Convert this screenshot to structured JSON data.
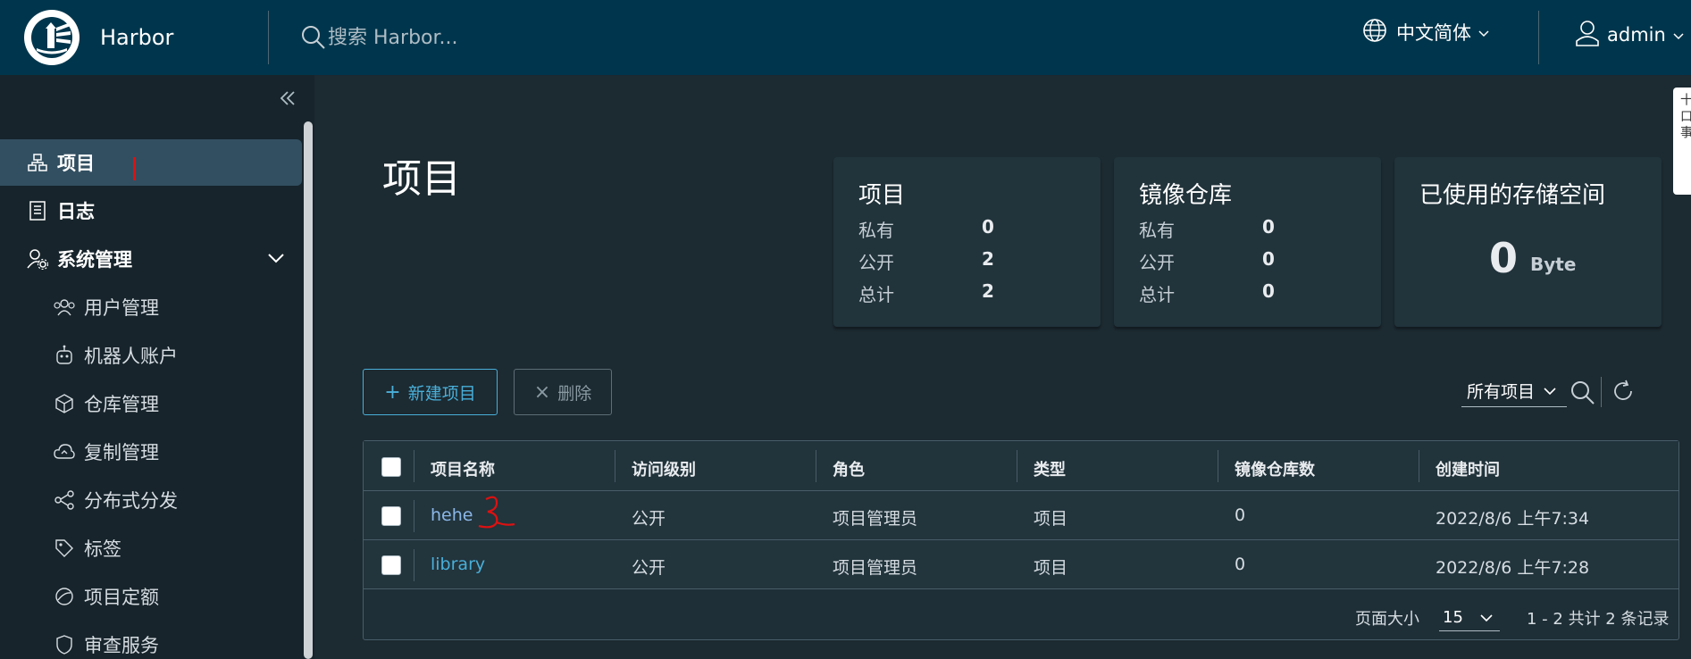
{
  "header": {
    "app_title": "Harbor",
    "search_placeholder": "搜索 Harbor...",
    "language": "中文简体",
    "user": "admin"
  },
  "sidebar": {
    "items": [
      {
        "label": "项目",
        "icon": "projects-icon",
        "active": true
      },
      {
        "label": "日志",
        "icon": "logs-icon"
      },
      {
        "label": "系统管理",
        "icon": "admin-icon",
        "expandable": true
      },
      {
        "label": "用户管理",
        "icon": "users-icon"
      },
      {
        "label": "机器人账户",
        "icon": "robot-icon"
      },
      {
        "label": "仓库管理",
        "icon": "cube-icon"
      },
      {
        "label": "复制管理",
        "icon": "cloud-icon"
      },
      {
        "label": "分布式分发",
        "icon": "share-icon"
      },
      {
        "label": "标签",
        "icon": "tag-icon"
      },
      {
        "label": "项目定额",
        "icon": "quota-icon"
      },
      {
        "label": "审查服务",
        "icon": "shield-icon"
      }
    ]
  },
  "main": {
    "page_title": "项目",
    "cards": {
      "projects": {
        "title": "项目",
        "rows": [
          {
            "label": "私有",
            "value": "0"
          },
          {
            "label": "公开",
            "value": "2"
          },
          {
            "label": "总计",
            "value": "2"
          }
        ]
      },
      "repos": {
        "title": "镜像仓库",
        "rows": [
          {
            "label": "私有",
            "value": "0"
          },
          {
            "label": "公开",
            "value": "0"
          },
          {
            "label": "总计",
            "value": "0"
          }
        ]
      },
      "storage": {
        "title": "已使用的存储空间",
        "value": "0",
        "unit": "Byte"
      }
    },
    "actions": {
      "new_project": "新建项目",
      "delete": "删除"
    },
    "filter": {
      "selected": "所有项目"
    },
    "table": {
      "columns": [
        "项目名称",
        "访问级别",
        "角色",
        "类型",
        "镜像仓库数",
        "创建时间"
      ],
      "rows": [
        {
          "name": "hehe",
          "access": "公开",
          "role": "项目管理员",
          "type": "项目",
          "repo_count": "0",
          "created": "2022/8/6 上午7:34"
        },
        {
          "name": "library",
          "access": "公开",
          "role": "项目管理员",
          "type": "项目",
          "repo_count": "0",
          "created": "2022/8/6 上午7:28"
        }
      ],
      "page_size_label": "页面大小",
      "page_size": "15",
      "page_info": "1 - 2 共计 2 条记录"
    }
  },
  "side_tab": "十 口 事",
  "colors": {
    "header": "#00364d",
    "accent": "#49afd9",
    "sidebar": "#17242b",
    "active": "#324f61",
    "annotation": "#dd1111"
  }
}
